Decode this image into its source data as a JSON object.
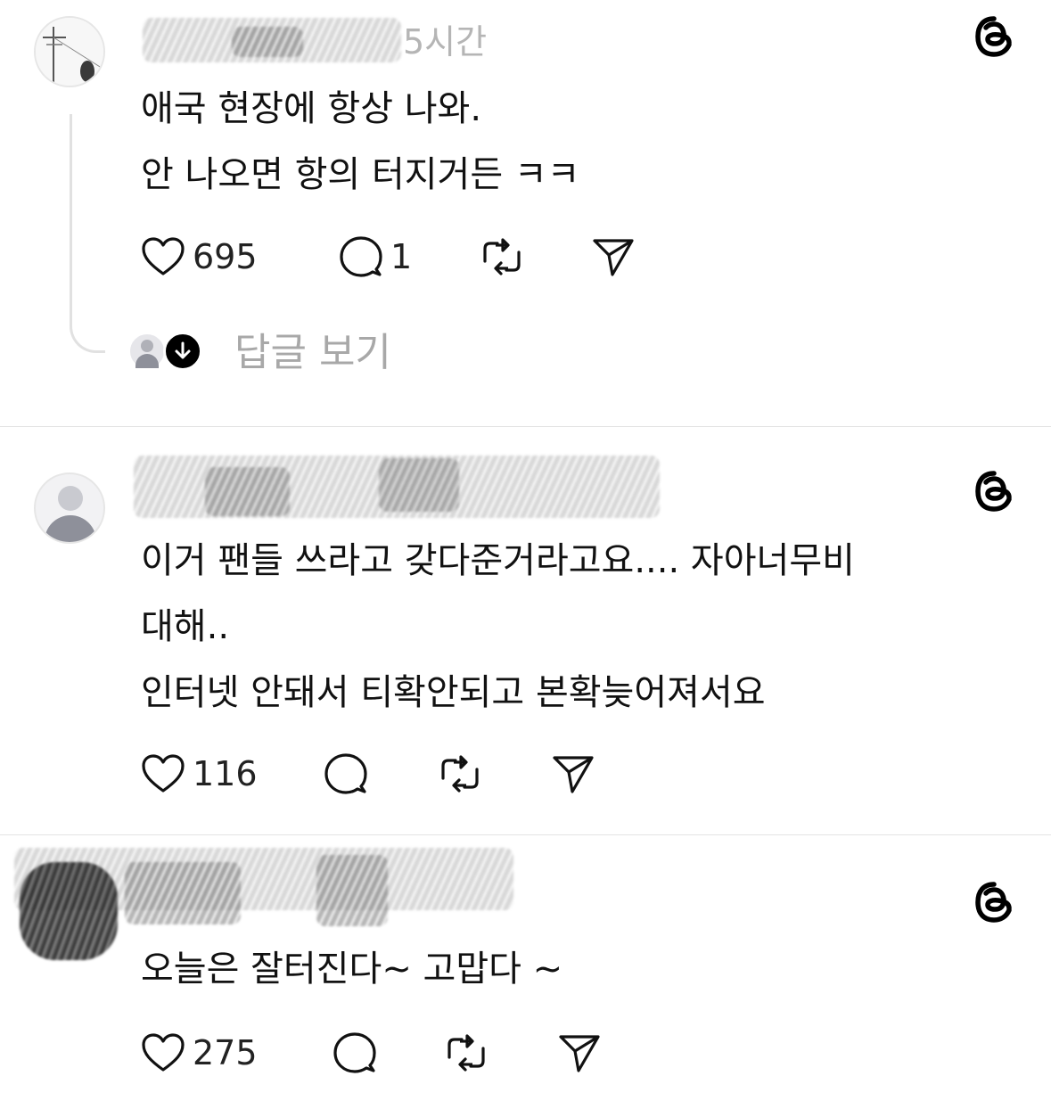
{
  "posts": [
    {
      "timestamp": "5시간",
      "lines": [
        "애국 현장에 항상 나와.",
        "안 나오면 항의 터지거든 ㅋㅋ"
      ],
      "likes": "695",
      "replies": "1",
      "view_replies_label": "답글 보기"
    },
    {
      "lines": [
        "이거 팬들 쓰라고 갖다준거라고요.... 자아너무비",
        "대해..",
        "인터넷 안돼서 티확안되고 본확늦어져서요"
      ],
      "likes": "116"
    },
    {
      "lines": [
        "오늘은 잘터진다~ 고맙다 ~"
      ],
      "likes": "275"
    }
  ],
  "icons": {
    "like": "heart-icon",
    "reply": "comment-icon",
    "repost": "repost-icon",
    "share": "send-icon",
    "app": "threads-logo-icon",
    "expand": "arrow-down-icon"
  },
  "colors": {
    "text": "#111111",
    "muted": "#a8a8a8",
    "divider": "#e3e3e3",
    "background": "#ffffff"
  }
}
